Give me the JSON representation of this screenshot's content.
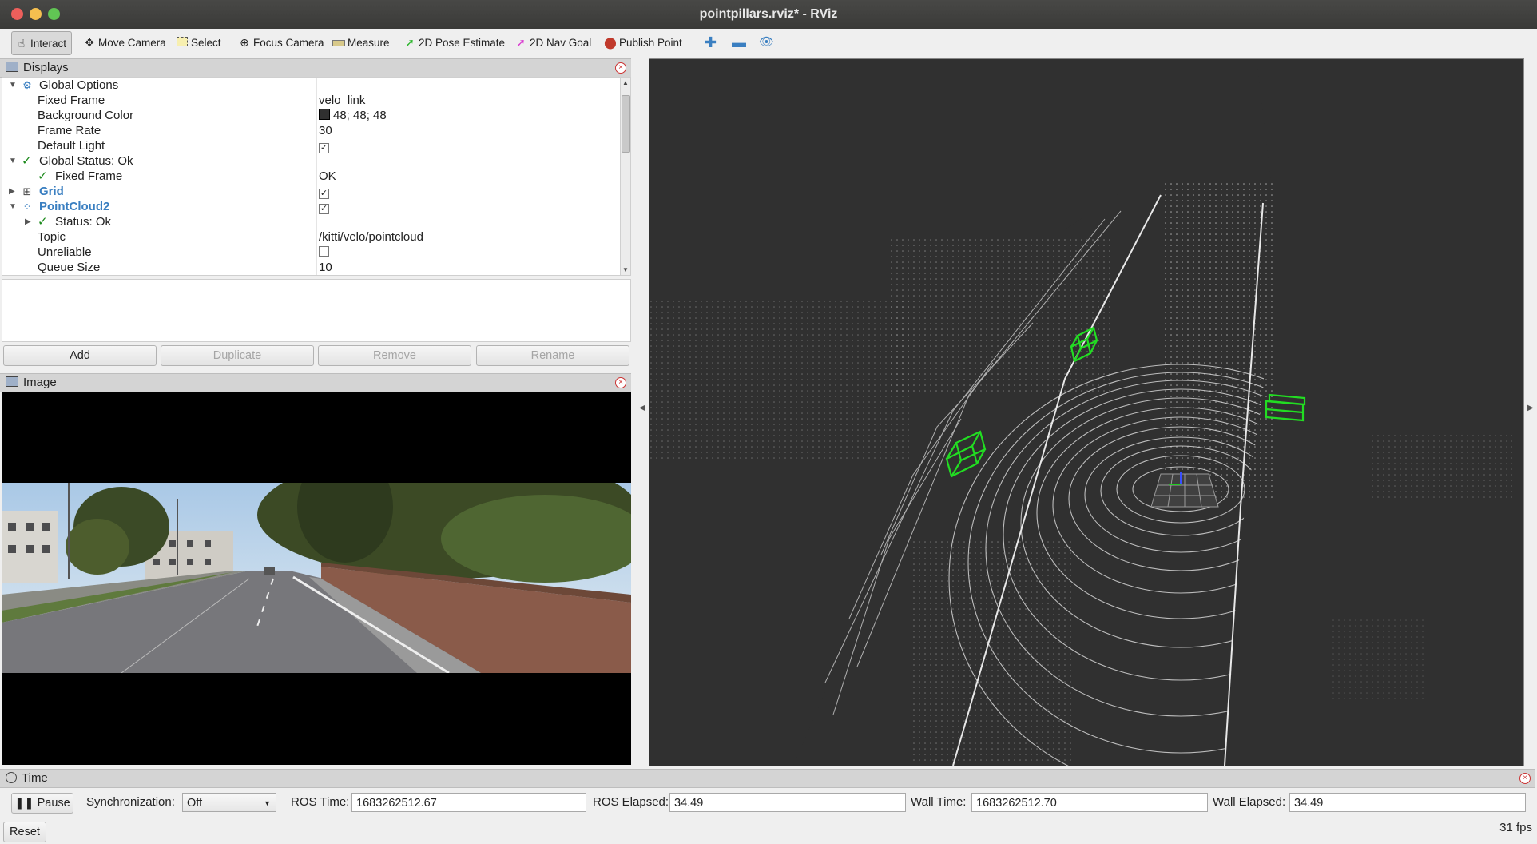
{
  "window": {
    "title": "pointpillars.rviz* - RViz"
  },
  "toolbar": {
    "tools": [
      {
        "label": "Interact",
        "icon": "hand-icon"
      },
      {
        "label": "Move Camera",
        "icon": "move-camera-icon"
      },
      {
        "label": "Select",
        "icon": "select-icon"
      },
      {
        "label": "Focus Camera",
        "icon": "focus-camera-icon"
      },
      {
        "label": "Measure",
        "icon": "ruler-icon"
      },
      {
        "label": "2D Pose Estimate",
        "icon": "green-arrow-icon"
      },
      {
        "label": "2D Nav Goal",
        "icon": "pink-arrow-icon"
      },
      {
        "label": "Publish Point",
        "icon": "map-pin-icon"
      }
    ]
  },
  "displays": {
    "title": "Displays",
    "rows": [
      {
        "label": "Global Options",
        "value": ""
      },
      {
        "label": "Fixed Frame",
        "value": "velo_link"
      },
      {
        "label": "Background Color",
        "value": "48; 48; 48"
      },
      {
        "label": "Frame Rate",
        "value": "30"
      },
      {
        "label": "Default Light",
        "value": "✓"
      },
      {
        "label": "Global Status: Ok",
        "value": ""
      },
      {
        "label": "Fixed Frame",
        "value": "OK"
      },
      {
        "label": "Grid",
        "value": "✓"
      },
      {
        "label": "PointCloud2",
        "value": "✓"
      },
      {
        "label": "Status: Ok",
        "value": ""
      },
      {
        "label": "Topic",
        "value": "/kitti/velo/pointcloud"
      },
      {
        "label": "Unreliable",
        "value": ""
      },
      {
        "label": "Queue Size",
        "value": "10"
      }
    ],
    "buttons": {
      "add": "Add",
      "duplicate": "Duplicate",
      "remove": "Remove",
      "rename": "Rename"
    }
  },
  "image_panel": {
    "title": "Image"
  },
  "time_panel": {
    "title": "Time",
    "pause": "Pause",
    "sync_label": "Synchronization:",
    "sync_value": "Off",
    "ros_time_label": "ROS Time:",
    "ros_time": "1683262512.67",
    "ros_elapsed_label": "ROS Elapsed:",
    "ros_elapsed": "34.49",
    "wall_time_label": "Wall Time:",
    "wall_time": "1683262512.70",
    "wall_elapsed_label": "Wall Elapsed:",
    "wall_elapsed": "34.49",
    "reset": "Reset",
    "fps": "31 fps"
  },
  "colors": {
    "viewport_bg": "#303030",
    "bbox": "#22dd22",
    "status_ok": "#1c8a1c",
    "link_blue": "#3a7fc1"
  }
}
